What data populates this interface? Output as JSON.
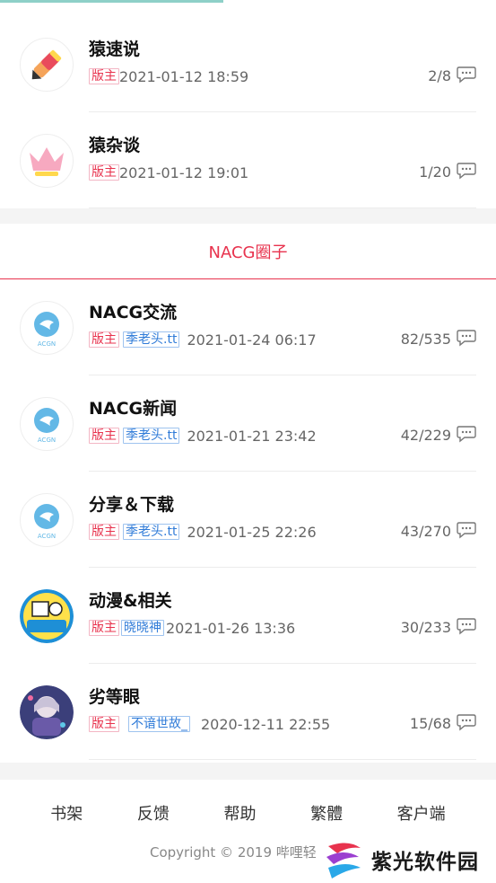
{
  "top_section": {
    "items": [
      {
        "title": "猿速说",
        "badges": [
          "版主"
        ],
        "time": "2021-01-12 18:59",
        "count": "2/8",
        "avatar_icon": "pencil-icon"
      },
      {
        "title": "猿杂谈",
        "badges": [
          "版主"
        ],
        "time": "2021-01-12 19:01",
        "count": "1/20",
        "avatar_icon": "crown-icon"
      }
    ]
  },
  "nacg": {
    "header": "NACG圈子",
    "items": [
      {
        "title": "NACG交流",
        "badges": [
          "版主"
        ],
        "user": "季老头.tt",
        "time": "2021-01-24 06:17",
        "count": "82/535",
        "avatar_icon": "acgn-logo-icon"
      },
      {
        "title": "NACG新闻",
        "badges": [
          "版主"
        ],
        "user": "季老头.tt",
        "time": "2021-01-21 23:42",
        "count": "42/229",
        "avatar_icon": "acgn-logo-icon"
      },
      {
        "title": "分享＆下载",
        "badges": [
          "版主"
        ],
        "user": "季老头.tt",
        "time": "2021-01-25 22:26",
        "count": "43/270",
        "avatar_icon": "acgn-logo-icon"
      },
      {
        "title": "动漫&相关",
        "badges": [
          "版主"
        ],
        "user": "晓晓神",
        "time": "2021-01-26 13:36",
        "count": "30/233",
        "avatar_icon": "anime-badge-icon"
      },
      {
        "title": "劣等眼",
        "badges": [
          "版主"
        ],
        "user": "不谙世故_",
        "time": "2020-12-11 22:55",
        "count": "15/68",
        "avatar_icon": "anime-character-icon"
      }
    ]
  },
  "footer": {
    "links": [
      "书架",
      "反馈",
      "帮助",
      "繁體",
      "客户端"
    ],
    "copyright": "Copyright © 2019 哔哩轻"
  },
  "watermark": {
    "text": "紫光软件园"
  },
  "colors": {
    "accent": "#e8334e",
    "user_badge": "#2f7bd8",
    "progress": "#8ed0c8"
  }
}
